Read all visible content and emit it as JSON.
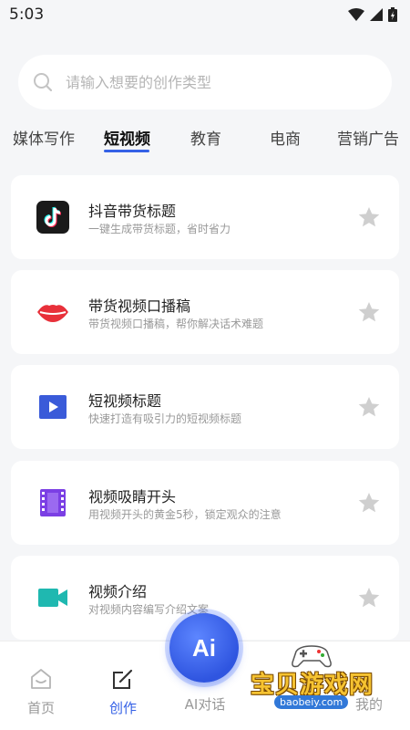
{
  "status_bar": {
    "time": "5:03"
  },
  "search": {
    "placeholder": "请输入想要的创作类型"
  },
  "tabs": [
    {
      "label": "媒体写作"
    },
    {
      "label": "短视频"
    },
    {
      "label": "教育"
    },
    {
      "label": "电商"
    },
    {
      "label": "营销广告"
    }
  ],
  "active_tab": "短视频",
  "cards": [
    {
      "title": "抖音带货标题",
      "desc": "一键生成带货标题，省时省力",
      "icon": "tiktok-icon"
    },
    {
      "title": "带货视频口播稿",
      "desc": "带货视频口播稿，帮你解决话术难题",
      "icon": "lips-icon"
    },
    {
      "title": "短视频标题",
      "desc": "快速打造有吸引力的短视频标题",
      "icon": "play-icon"
    },
    {
      "title": "视频吸睛开头",
      "desc": "用视频开头的黄金5秒，锁定观众的注意",
      "icon": "film-icon"
    },
    {
      "title": "视频介绍",
      "desc": "对视频内容编写介绍文案",
      "icon": "video-camera-icon"
    }
  ],
  "bottom_nav": {
    "home_label": "首页",
    "create_label": "创作",
    "ai_label": "AI对话",
    "mine_label": "我的",
    "ai_button_text": "Ai"
  },
  "colors": {
    "accent": "#3561e6",
    "background": "#f5f6f8",
    "star": "#cfcfcf"
  },
  "watermark": {
    "text": "宝贝游戏网",
    "url": "baobeiy.com"
  }
}
